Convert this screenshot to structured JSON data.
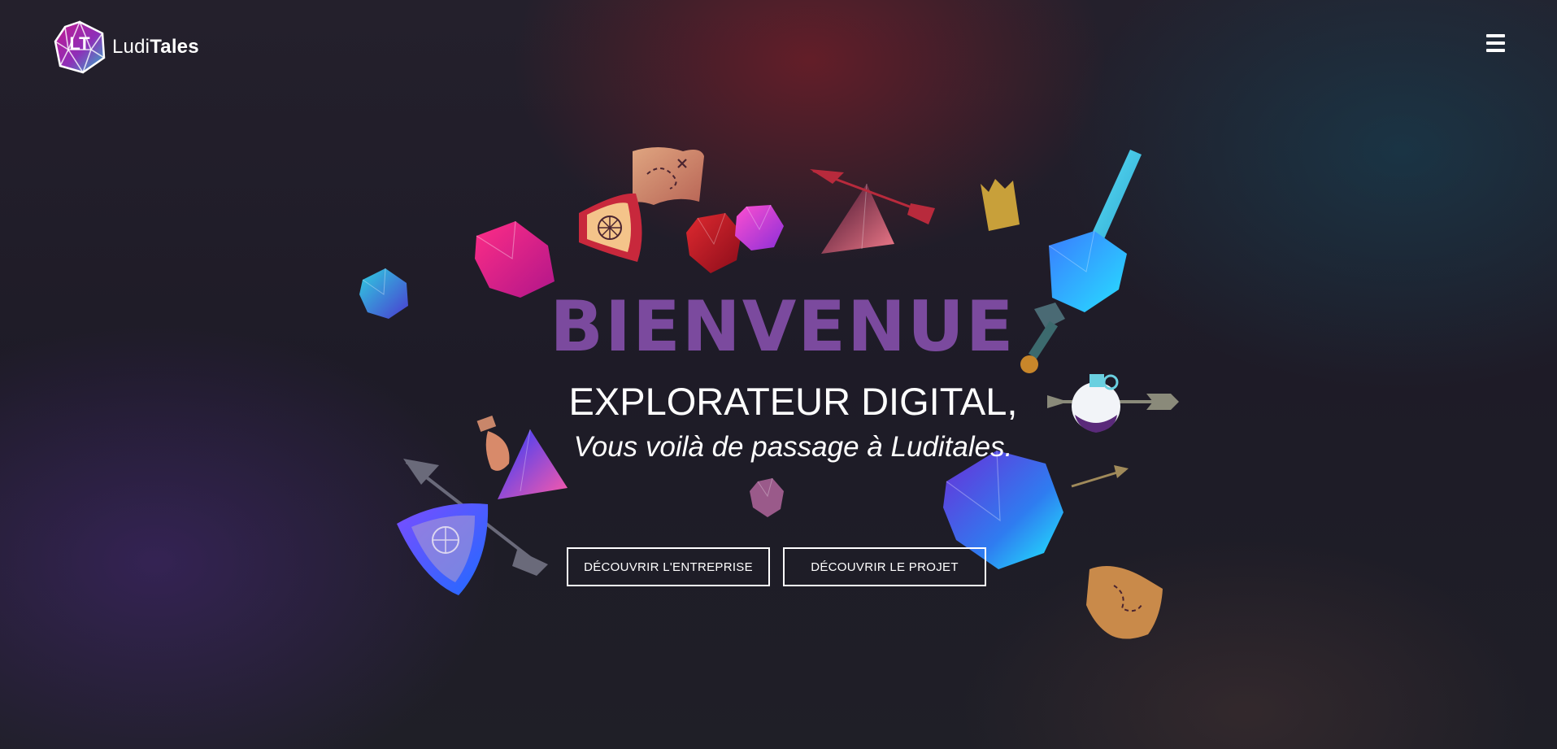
{
  "header": {
    "logo_prefix": "Ludi",
    "logo_suffix": "Tales",
    "logo_glyph": "LT"
  },
  "hero": {
    "title": "BIENVENUE",
    "subtitle": "EXPLORATEUR DIGITAL,",
    "tagline": "Vous voilà de passage à Luditales."
  },
  "buttons": {
    "company_label": "DÉCOUVRIR L'ENTREPRISE",
    "project_label": "DÉCOUVRIR LE PROJET"
  },
  "icons": {
    "menu": "hamburger-menu-icon",
    "logo": "d20-logo-icon"
  },
  "colors": {
    "title_purple": "#7b4a9e",
    "text_white": "#ffffff",
    "background_dark": "#1f1c28"
  }
}
